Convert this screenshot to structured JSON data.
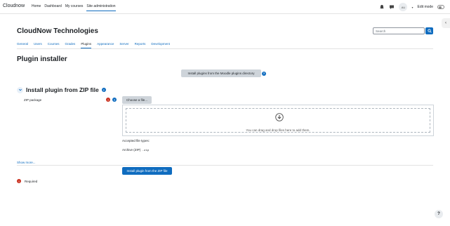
{
  "navbar": {
    "brand": "Cloudnow",
    "links": [
      "Home",
      "Dashboard",
      "My courses",
      "Site administration"
    ],
    "active_link": "Site administration",
    "user_initials": "AU",
    "edit_mode_label": "Edit mode",
    "edit_mode_on": false
  },
  "header": {
    "site_title": "CloudNow Technologies",
    "search_placeholder": "Search"
  },
  "tabs": [
    {
      "label": "General",
      "current": false
    },
    {
      "label": "Users",
      "current": false
    },
    {
      "label": "Courses",
      "current": false
    },
    {
      "label": "Grades",
      "current": false
    },
    {
      "label": "Plugins",
      "current": true
    },
    {
      "label": "Appearance",
      "current": false
    },
    {
      "label": "Server",
      "current": false
    },
    {
      "label": "Reports",
      "current": false
    },
    {
      "label": "Development",
      "current": false
    }
  ],
  "page": {
    "heading": "Plugin installer",
    "directory_button": "Install plugins from the Moodle plugins directory",
    "section_title": "Install plugin from ZIP file",
    "field_label": "ZIP package",
    "choose_button": "Choose a file...",
    "dropzone_text": "You can drag and drop files here to add them.",
    "accepted_label": "Accepted file types:",
    "archive_label": "Archive (ZIP)",
    "archive_ext": ".zip",
    "show_more": "Show more...",
    "submit_button": "Install plugin from the ZIP file",
    "required_legend": "Required"
  },
  "icons": {
    "required": "!",
    "help": "?",
    "footer_help": "?",
    "drawer": "‹"
  },
  "colors": {
    "primary": "#0f6cbf",
    "danger": "#ca3120",
    "secondary_btn": "#ced4da"
  }
}
